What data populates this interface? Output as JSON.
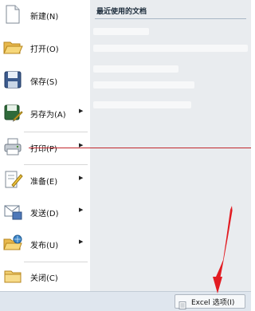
{
  "menu": {
    "items": [
      {
        "label": "新建(N)",
        "icon": "new-document-icon",
        "has_submenu": false
      },
      {
        "label": "打开(O)",
        "icon": "open-folder-icon",
        "has_submenu": false
      },
      {
        "label": "保存(S)",
        "icon": "save-disk-icon",
        "has_submenu": false
      },
      {
        "label": "另存为(A)",
        "icon": "save-as-icon",
        "has_submenu": true
      },
      {
        "label": "打印(P)",
        "icon": "printer-icon",
        "has_submenu": true
      },
      {
        "label": "准备(E)",
        "icon": "prepare-document-icon",
        "has_submenu": true
      },
      {
        "label": "发送(D)",
        "icon": "send-icon",
        "has_submenu": true
      },
      {
        "label": "发布(U)",
        "icon": "publish-icon",
        "has_submenu": true
      },
      {
        "label": "关闭(C)",
        "icon": "close-folder-icon",
        "has_submenu": false
      }
    ],
    "submenu_arrow": "▶"
  },
  "recent": {
    "title": "最近使用的文档"
  },
  "bottom": {
    "options_label": "Excel 选项(I)",
    "options_icon": "options-document-icon"
  },
  "colors": {
    "annotation_red": "#d8141c",
    "pane_bg": "#e9ecef"
  }
}
